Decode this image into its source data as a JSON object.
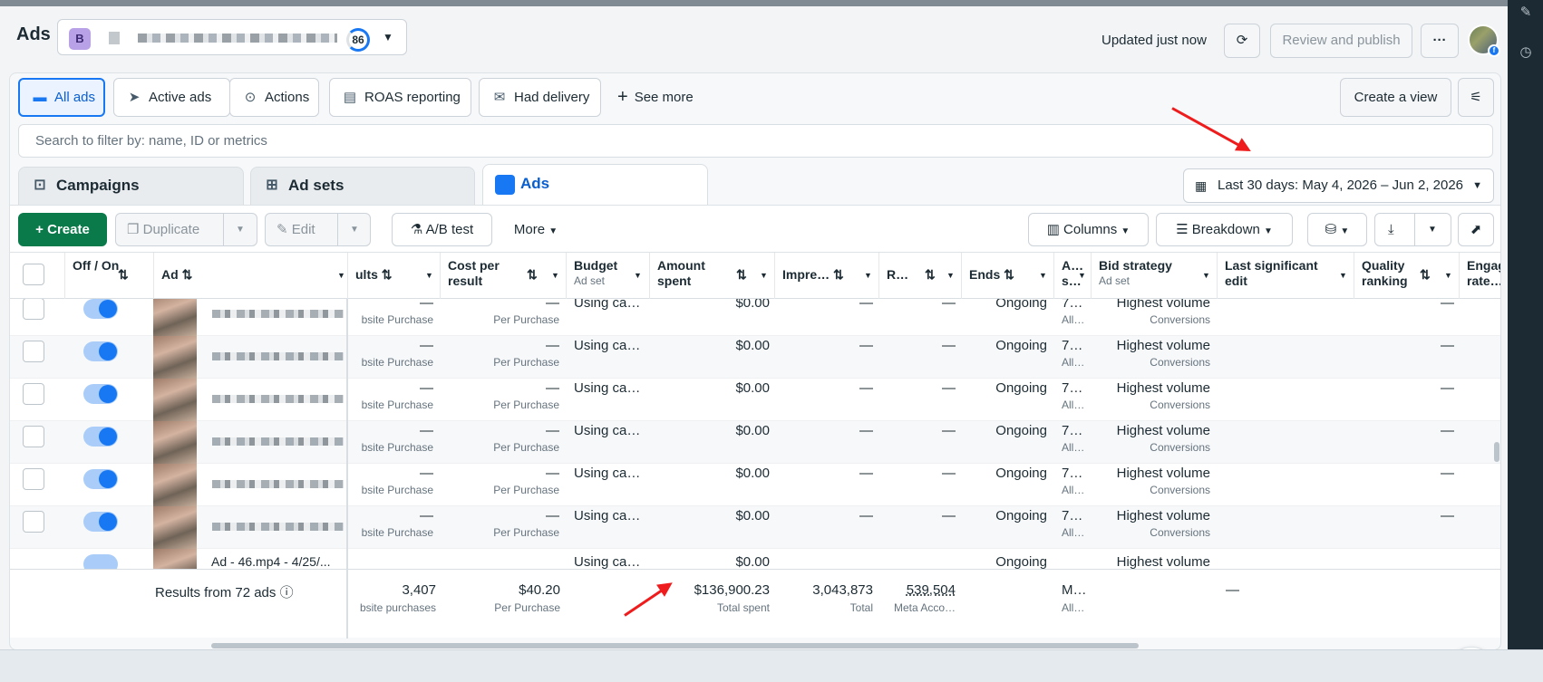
{
  "header": {
    "title": "Ads",
    "account_badge": "B",
    "account_score": "86",
    "updated": "Updated just now",
    "review_publish": "Review and publish",
    "more": "···"
  },
  "views": [
    {
      "label": "All ads",
      "icon": "folder-icon"
    },
    {
      "label": "Active ads",
      "icon": "send-icon"
    },
    {
      "label": "Actions",
      "icon": "action-icon"
    },
    {
      "label": "ROAS reporting",
      "icon": "report-icon"
    },
    {
      "label": "Had delivery",
      "icon": "envelope-icon"
    }
  ],
  "see_more": "See more",
  "create_view": "Create a view",
  "search": {
    "placeholder": "Search to filter by: name, ID or metrics"
  },
  "level_tabs": [
    {
      "label": "Campaigns"
    },
    {
      "label": "Ad sets"
    },
    {
      "label": "Ads"
    }
  ],
  "date_range": "Last 30 days: May 4, 2026 – Jun 2, 2026",
  "toolbar": {
    "create": "Create",
    "duplicate": "Duplicate",
    "edit": "Edit",
    "ab_test": "A/B test",
    "more": "More",
    "columns": "Columns",
    "breakdown": "Breakdown"
  },
  "columns": {
    "off_on": "Off / On",
    "ad": "Ad",
    "results": "ults",
    "cost_per_result": "Cost per result",
    "budget": "Budget",
    "budget_sub": "Ad set",
    "amount_spent": "Amount spent",
    "impressions": "Impre…",
    "reach": "R…",
    "ends": "Ends",
    "attribution": "A… s…",
    "bid_strategy": "Bid strategy",
    "bid_strategy_sub": "Ad set",
    "last_edit": "Last significant edit",
    "quality": "Quality ranking",
    "engagement": "Engage rate…"
  },
  "rows": [
    {
      "results": "—",
      "results_sub": "bsite Purchase",
      "cpr": "—",
      "cpr_sub": "Per Purchase",
      "budget": "Using ca…",
      "spent": "$0.00",
      "impr": "—",
      "reach": "—",
      "ends": "Ongoing",
      "attr": "7…",
      "attr_sub": "All…",
      "bid": "Highest volume",
      "bid_sub": "Conversions",
      "quality": "—"
    },
    {
      "results": "—",
      "results_sub": "bsite Purchase",
      "cpr": "—",
      "cpr_sub": "Per Purchase",
      "budget": "Using ca…",
      "spent": "$0.00",
      "impr": "—",
      "reach": "—",
      "ends": "Ongoing",
      "attr": "7…",
      "attr_sub": "All…",
      "bid": "Highest volume",
      "bid_sub": "Conversions",
      "quality": "—"
    },
    {
      "results": "—",
      "results_sub": "bsite Purchase",
      "cpr": "—",
      "cpr_sub": "Per Purchase",
      "budget": "Using ca…",
      "spent": "$0.00",
      "impr": "—",
      "reach": "—",
      "ends": "Ongoing",
      "attr": "7…",
      "attr_sub": "All…",
      "bid": "Highest volume",
      "bid_sub": "Conversions",
      "quality": "—"
    },
    {
      "results": "—",
      "results_sub": "bsite Purchase",
      "cpr": "—",
      "cpr_sub": "Per Purchase",
      "budget": "Using ca…",
      "spent": "$0.00",
      "impr": "—",
      "reach": "—",
      "ends": "Ongoing",
      "attr": "7…",
      "attr_sub": "All…",
      "bid": "Highest volume",
      "bid_sub": "Conversions",
      "quality": "—"
    },
    {
      "results": "—",
      "results_sub": "bsite Purchase",
      "cpr": "—",
      "cpr_sub": "Per Purchase",
      "budget": "Using ca…",
      "spent": "$0.00",
      "impr": "—",
      "reach": "—",
      "ends": "Ongoing",
      "attr": "7…",
      "attr_sub": "All…",
      "bid": "Highest volume",
      "bid_sub": "Conversions",
      "quality": "—"
    },
    {
      "results": "—",
      "results_sub": "bsite Purchase",
      "cpr": "—",
      "cpr_sub": "Per Purchase",
      "budget": "Using ca…",
      "spent": "$0.00",
      "impr": "—",
      "reach": "—",
      "ends": "Ongoing",
      "attr": "7…",
      "attr_sub": "All…",
      "bid": "Highest volume",
      "bid_sub": "Conversions",
      "quality": "—"
    }
  ],
  "partial_row": {
    "ad": "Ad - 46.mp4 - 4/25/...",
    "budget": "Using ca…",
    "spent": "$0.00",
    "ends": "Ongoing",
    "bid": "Highest volume"
  },
  "totals": {
    "label": "Results from 72 ads",
    "results": "3,407",
    "results_sub": "bsite purchases",
    "cpr": "$40.20",
    "cpr_sub": "Per Purchase",
    "spent": "$136,900.23",
    "spent_sub": "Total spent",
    "impr": "3,043,873",
    "impr_sub": "Total",
    "reach": "539,504",
    "reach_sub": "Meta Acco…",
    "attr": "M…",
    "attr_sub": "All…",
    "last_edit": "—"
  },
  "colors": {
    "accent": "#1877f2",
    "create": "#0a7a4a",
    "annotation_arrow": "#ee1c1c"
  }
}
